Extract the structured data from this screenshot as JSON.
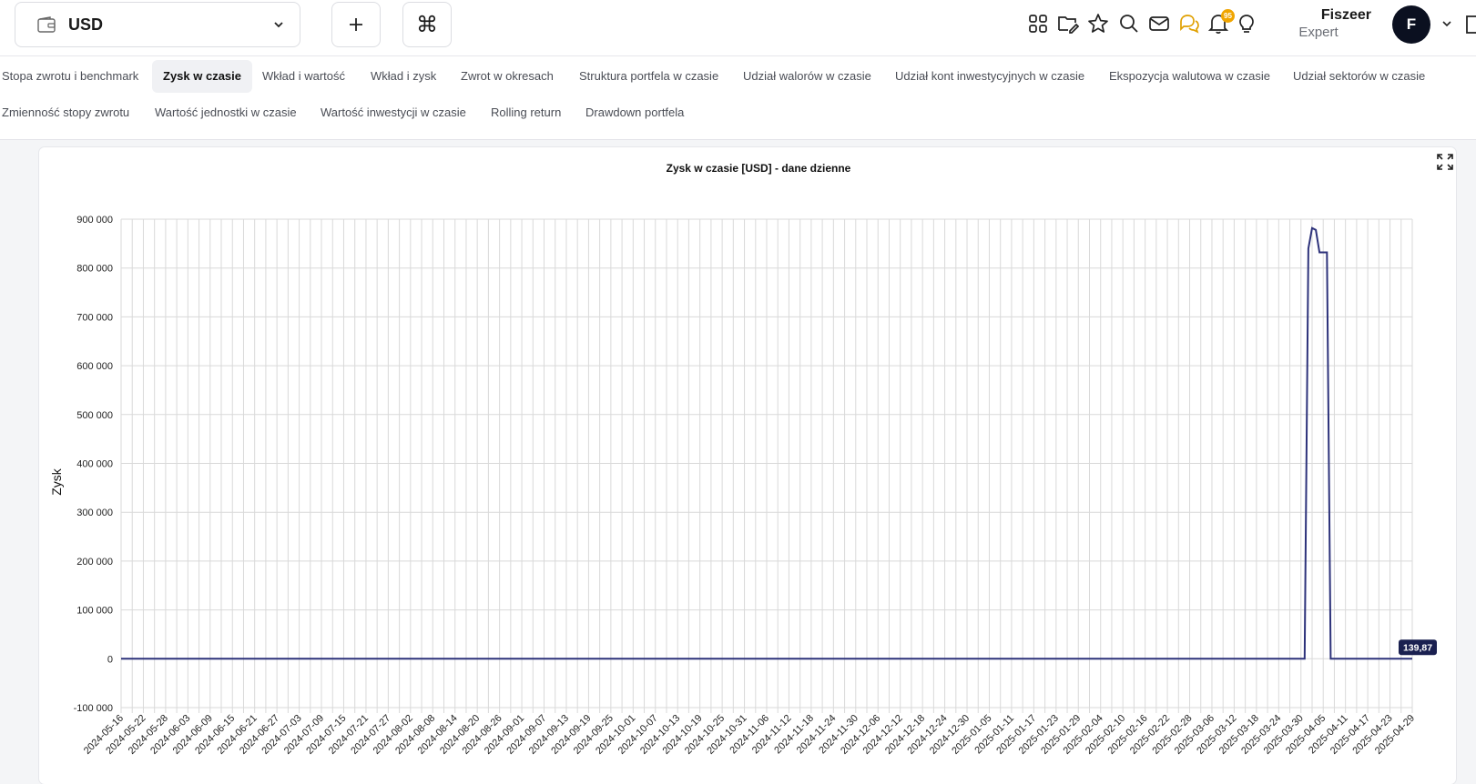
{
  "header": {
    "currency": "USD",
    "user_name": "Fiszeer",
    "user_role": "Expert",
    "avatar_initial": "F",
    "notification_count": "95",
    "icons": [
      "apps-grid-icon",
      "folder-edit-icon",
      "star-icon",
      "search-icon",
      "mail-icon",
      "chat-icon",
      "bell-icon",
      "lightbulb-icon"
    ]
  },
  "tabs": [
    "Stopa zwrotu i benchmark",
    "Zysk w czasie",
    "Wkład i wartość",
    "Wkład i zysk",
    "Zwrot w okresach",
    "Struktura portfela w czasie",
    "Udział walorów w czasie",
    "Udział kont inwestycyjnych w czasie",
    "Ekspozycja walutowa w czasie",
    "Udział sektorów w czasie",
    "Zmienność stopy zwrotu",
    "Wartość jednostki w czasie",
    "Wartość inwestycji w czasie",
    "Rolling return",
    "Drawdown portfela"
  ],
  "active_tab": "Zysk w czasie",
  "colors": {
    "line": "#2d327a",
    "grid": "#d9d9d9",
    "label_bg": "#1a2050"
  },
  "chart_data": {
    "type": "line",
    "title": "Zysk w czasie [USD] - dane dzienne",
    "ylabel": "Zysk",
    "xlabel": "",
    "ylim": [
      -100000,
      900000
    ],
    "yticks": [
      "900 000",
      "800 000",
      "700 000",
      "600 000",
      "500 000",
      "400 000",
      "300 000",
      "200 000",
      "100 000",
      "0",
      "-100 000"
    ],
    "grid": true,
    "x_start": "2024-05-16",
    "x_end": "2025-04-29",
    "x_tick_labels": [
      "2024-05-16",
      "2024-05-22",
      "2024-05-28",
      "2024-06-03",
      "2024-06-09",
      "2024-06-15",
      "2024-06-21",
      "2024-06-27",
      "2024-07-03",
      "2024-07-09",
      "2024-07-15",
      "2024-07-21",
      "2024-07-27",
      "2024-08-02",
      "2024-08-08",
      "2024-08-14",
      "2024-08-20",
      "2024-08-26",
      "2024-09-01",
      "2024-09-07",
      "2024-09-13",
      "2024-09-19",
      "2024-09-25",
      "2024-10-01",
      "2024-10-07",
      "2024-10-13",
      "2024-10-19",
      "2024-10-25",
      "2024-10-31",
      "2024-11-06",
      "2024-11-12",
      "2024-11-18",
      "2024-11-24",
      "2024-11-30",
      "2024-12-06",
      "2024-12-12",
      "2024-12-18",
      "2024-12-24",
      "2024-12-30",
      "2025-01-05",
      "2025-01-11",
      "2025-01-17",
      "2025-01-23",
      "2025-01-29",
      "2025-02-04",
      "2025-02-10",
      "2025-02-16",
      "2025-02-22",
      "2025-02-28",
      "2025-03-06",
      "2025-03-12",
      "2025-03-18",
      "2025-03-24",
      "2025-03-30",
      "2025-04-05",
      "2025-04-11",
      "2025-04-17",
      "2025-04-23",
      "2025-04-29"
    ],
    "series": [
      {
        "points": [
          [
            "2024-05-16",
            0
          ],
          [
            "2025-03-31",
            0
          ],
          [
            "2025-04-01",
            840000
          ],
          [
            "2025-04-02",
            882000
          ],
          [
            "2025-04-03",
            878000
          ],
          [
            "2025-04-04",
            832000
          ],
          [
            "2025-04-05",
            832000
          ],
          [
            "2025-04-06",
            832000
          ],
          [
            "2025-04-07",
            0
          ],
          [
            "2025-04-29",
            139.87
          ]
        ]
      }
    ],
    "last_value_label": "139,87"
  }
}
